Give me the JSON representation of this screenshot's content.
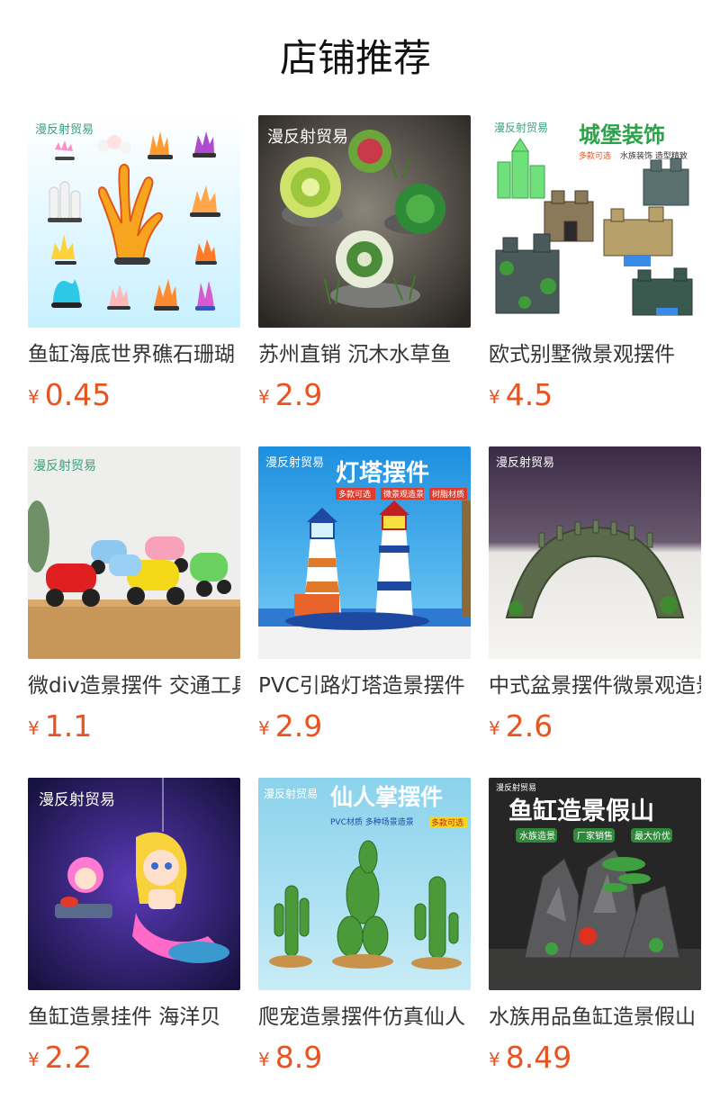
{
  "header": {
    "title": "店铺推荐"
  },
  "products": [
    {
      "name": "鱼缸海底世界礁石珊瑚",
      "currency": "¥",
      "price": "0.45",
      "image_brand": "漫反射贸易"
    },
    {
      "name": "苏州直销 沉木水草鱼",
      "currency": "¥",
      "price": "2.9",
      "image_brand": "漫反射贸易"
    },
    {
      "name": "欧式别墅微景观摆件",
      "currency": "¥",
      "price": "4.5",
      "image_brand": "漫反射贸易",
      "image_title": "城堡装饰",
      "image_tags": [
        "多款可选",
        "水族装饰 造型精致"
      ]
    },
    {
      "name": "微div造景摆件 交通工具",
      "currency": "¥",
      "price": "1.1",
      "image_brand": "漫反射贸易"
    },
    {
      "name": "PVC引路灯塔造景摆件",
      "currency": "¥",
      "price": "2.9",
      "image_brand": "漫反射贸易",
      "image_title": "灯塔摆件",
      "image_tags": [
        "多款可选",
        "微景观造景",
        "树脂材质"
      ]
    },
    {
      "name": "中式盆景摆件微景观造景",
      "currency": "¥",
      "price": "2.6",
      "image_brand": "漫反射贸易"
    },
    {
      "name": "鱼缸造景挂件 海洋贝",
      "currency": "¥",
      "price": "2.2",
      "image_brand": "漫反射贸易"
    },
    {
      "name": "爬宠造景摆件仿真仙人",
      "currency": "¥",
      "price": "8.9",
      "image_brand": "漫反射贸易",
      "image_title": "仙人掌摆件",
      "image_tags": [
        "PVC材质 多种场景造景",
        "多款可选"
      ]
    },
    {
      "name": "水族用品鱼缸造景假山",
      "currency": "¥",
      "price": "8.49",
      "image_brand": "漫反射贸易",
      "image_title": "鱼缸造景假山",
      "image_tags": [
        "水族造景",
        "厂家销售",
        "最大价优"
      ]
    }
  ],
  "colors": {
    "price": "#e8541f",
    "title": "#111111",
    "name": "#333333"
  }
}
